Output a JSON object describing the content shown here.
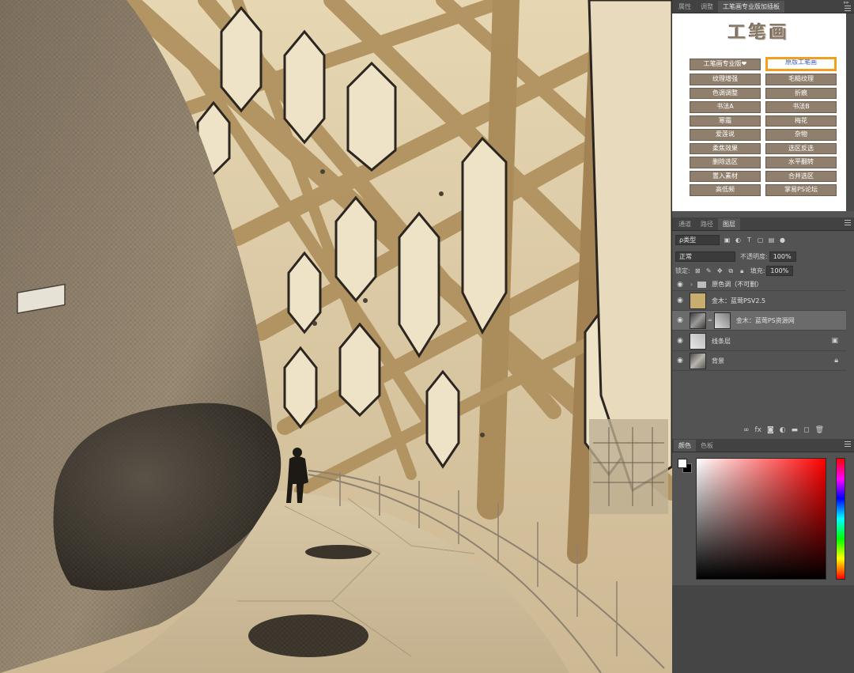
{
  "plugin_tabs": [
    "属性",
    "调整",
    "工笔画专业版加插板"
  ],
  "plugin_title": "工笔画",
  "plugin_buttons": [
    {
      "label": "工笔画专业版❤",
      "selected": false
    },
    {
      "label": "原版工笔画",
      "selected": true
    },
    {
      "label": "纹理增强",
      "selected": false
    },
    {
      "label": "毛糙纹理",
      "selected": false
    },
    {
      "label": "色调调整",
      "selected": false
    },
    {
      "label": "折痕",
      "selected": false
    },
    {
      "label": "书法A",
      "selected": false
    },
    {
      "label": "书法B",
      "selected": false
    },
    {
      "label": "寒霜",
      "selected": false
    },
    {
      "label": "梅花",
      "selected": false
    },
    {
      "label": "爱莲说",
      "selected": false
    },
    {
      "label": "杂物",
      "selected": false
    },
    {
      "label": "柔焦效果",
      "selected": false
    },
    {
      "label": "选区反选",
      "selected": false
    },
    {
      "label": "删除选区",
      "selected": false
    },
    {
      "label": "水平翻转",
      "selected": false
    },
    {
      "label": "置入素材",
      "selected": false
    },
    {
      "label": "合并选区",
      "selected": false
    },
    {
      "label": "高低频",
      "selected": false
    },
    {
      "label": "掌易PS论坛",
      "selected": false
    }
  ],
  "layers_tabs": [
    "通道",
    "路径",
    "图层"
  ],
  "layer_filter": {
    "label": "ρ类型"
  },
  "blend_mode": "正常",
  "opacity": {
    "label": "不透明度:",
    "value": "100%"
  },
  "lock_label": "锁定:",
  "fill": {
    "label": "填充:",
    "value": "100%"
  },
  "layers": [
    {
      "name": "原色调（不可删）",
      "type": "group",
      "badge": ""
    },
    {
      "name": "金木：蓝莺PSV2.5",
      "type": "fill",
      "badge": ""
    },
    {
      "name": "金木：蓝莺PS资源网",
      "type": "mask",
      "badge": "",
      "active": true
    },
    {
      "name": "线条层",
      "type": "texture",
      "badge": "fx"
    },
    {
      "name": "背景",
      "type": "photo",
      "badge": "lock"
    }
  ],
  "layer_footer_icons": [
    "link-icon",
    "fx-icon",
    "mask-icon",
    "adjustment-icon",
    "folder-icon",
    "new-layer-icon",
    "trash-icon"
  ],
  "color_tabs": [
    "颜色",
    "色板"
  ],
  "colors": {
    "foreground": "#ffffff",
    "background": "#000000",
    "accent": "#f0a01e",
    "button": "#8f7f6c"
  }
}
